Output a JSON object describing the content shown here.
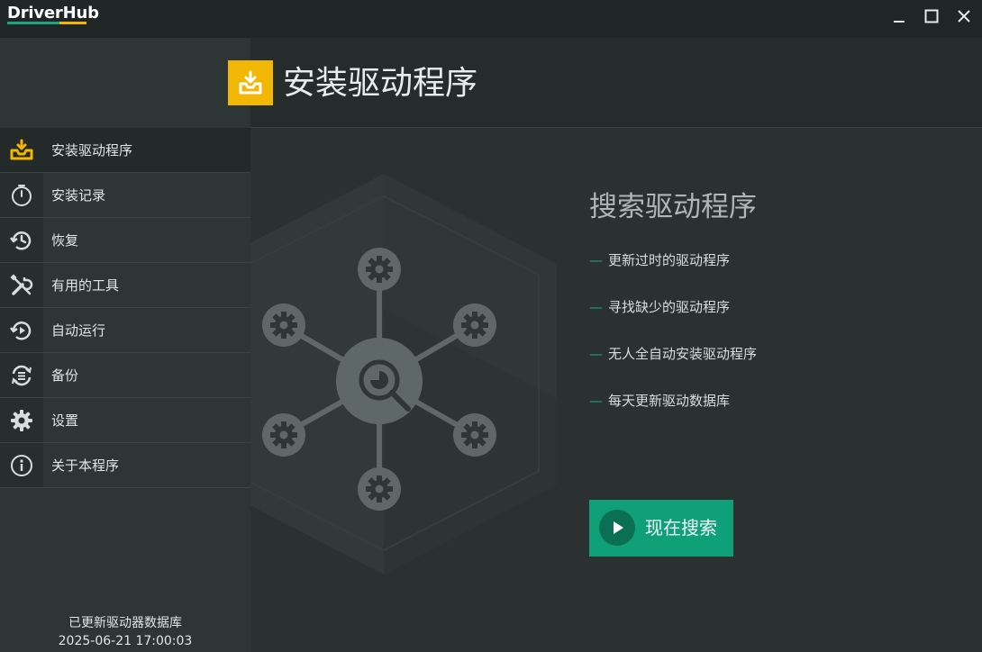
{
  "app": {
    "logo_text": "DriverHub"
  },
  "window_controls": [
    "minimize",
    "maximize",
    "close"
  ],
  "header": {
    "title": "安装驱动程序",
    "icon": "install-tray-icon"
  },
  "sidebar": {
    "items": [
      {
        "label": "安装驱动程序",
        "icon": "install-tray-icon",
        "active": true
      },
      {
        "label": "安装记录",
        "icon": "stopwatch-icon",
        "active": false
      },
      {
        "label": "恢复",
        "icon": "history-restore-icon",
        "active": false
      },
      {
        "label": "有用的工具",
        "icon": "tools-icon",
        "active": false
      },
      {
        "label": "自动运行",
        "icon": "autorun-icon",
        "active": false
      },
      {
        "label": "备份",
        "icon": "backup-icon",
        "active": false
      },
      {
        "label": "设置",
        "icon": "gear-icon",
        "active": false
      },
      {
        "label": "关于本程序",
        "icon": "info-icon",
        "active": false
      }
    ],
    "db_status_label": "已更新驱动器数据库",
    "db_status_time": "2025-06-21 17:00:03"
  },
  "main": {
    "search_title": "搜索驱动程序",
    "features": [
      "更新过时的驱动程序",
      "寻找缺少的驱动程序",
      "无人全自动安装驱动程序",
      "每天更新驱动数据库"
    ],
    "feature_dash": "—",
    "scan_button_label": "现在搜索"
  },
  "colors": {
    "accent_green": "#0fa07a",
    "accent_yellow": "#f2b705",
    "background": "#2b3131",
    "sidebar": "#2d3535"
  }
}
